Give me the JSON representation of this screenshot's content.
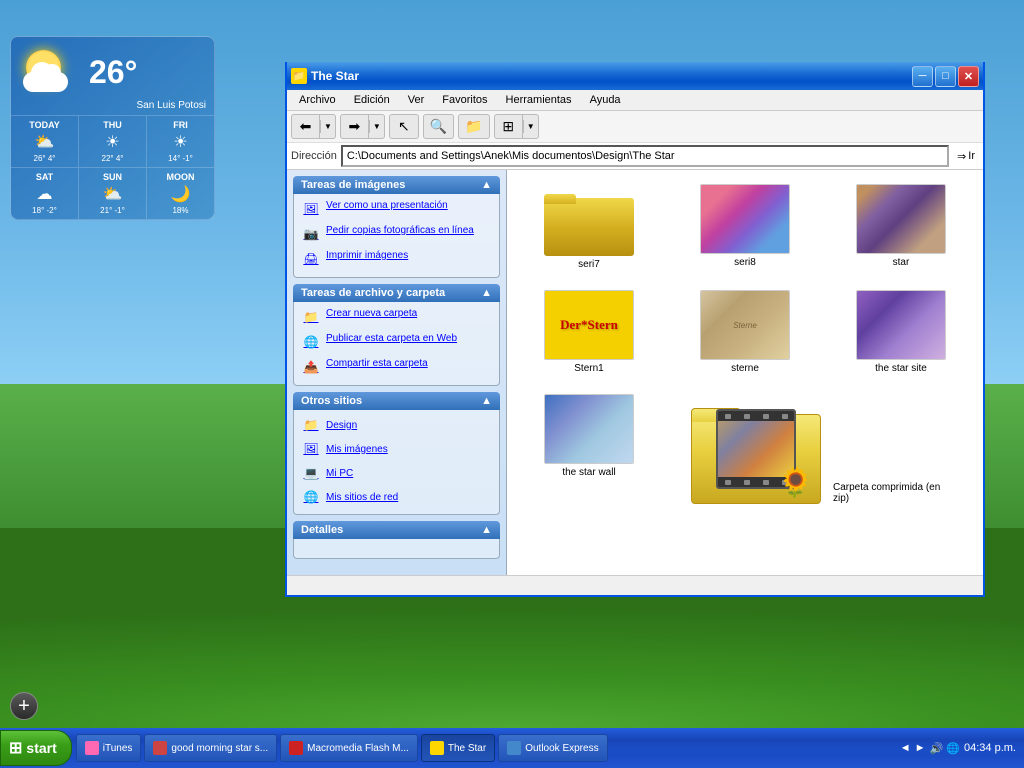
{
  "desktop": {
    "background": "Windows XP Bliss"
  },
  "taskbar": {
    "start_label": "start",
    "clock": "04:34 p.m.",
    "buttons": [
      {
        "id": "itunes",
        "label": "iTunes",
        "color": "#ff69b4",
        "active": false
      },
      {
        "id": "good-morning",
        "label": "good morning star s...",
        "color": "#cc4444",
        "active": false
      },
      {
        "id": "macromedia",
        "label": "Macromedia Flash M...",
        "color": "#cc2222",
        "active": false
      },
      {
        "id": "the-star",
        "label": "The Star",
        "color": "#ffd700",
        "active": true
      },
      {
        "id": "outlook",
        "label": "Outlook Express",
        "color": "#4488cc",
        "active": false
      }
    ]
  },
  "weather": {
    "temp_today": "26°",
    "location": "San Luis Potosi",
    "days": [
      {
        "name": "TODAY",
        "icon": "⛅",
        "hi": "26°",
        "lo": "4°"
      },
      {
        "name": "THU",
        "icon": "☀",
        "hi": "22°",
        "lo": "4°"
      },
      {
        "name": "FRI",
        "icon": "☀",
        "hi": "14°",
        "lo": "-1°"
      }
    ],
    "forecast": [
      {
        "name": "SAT",
        "icon": "☁",
        "hi": "18°",
        "lo": "-2°"
      },
      {
        "name": "SUN",
        "icon": "⛅",
        "hi": "21°",
        "lo": "-1°"
      },
      {
        "name": "MOON",
        "icon": "🌙",
        "value": "18%"
      }
    ]
  },
  "explorer": {
    "title": "The Star",
    "address": "C:\\Documents and Settings\\Anek\\Mis documentos\\Design\\The Star",
    "address_label": "Dirección",
    "go_label": "Ir",
    "menu": {
      "items": [
        "Archivo",
        "Edición",
        "Ver",
        "Favoritos",
        "Herramientas",
        "Ayuda"
      ]
    },
    "toolbar": {
      "back_arrow": "◄",
      "forward_arrow": "►",
      "dropdown": "▼"
    },
    "sidebar": {
      "sections": [
        {
          "id": "image-tasks",
          "header": "Tareas de imágenes",
          "links": [
            {
              "icon": "🖼",
              "label": "Ver como una presentación"
            },
            {
              "icon": "📷",
              "label": "Pedir copias fotográficas en línea"
            },
            {
              "icon": "🖨",
              "label": "Imprimir imágenes"
            }
          ]
        },
        {
          "id": "file-tasks",
          "header": "Tareas de archivo y carpeta",
          "links": [
            {
              "icon": "📁",
              "label": "Crear nueva carpeta"
            },
            {
              "icon": "🌐",
              "label": "Publicar esta carpeta en Web"
            },
            {
              "icon": "📤",
              "label": "Compartir esta carpeta"
            }
          ]
        },
        {
          "id": "other-sites",
          "header": "Otros sitios",
          "links": [
            {
              "icon": "📁",
              "label": "Design"
            },
            {
              "icon": "🖼",
              "label": "Mis imágenes"
            },
            {
              "icon": "💻",
              "label": "Mi PC"
            },
            {
              "icon": "🌐",
              "label": "Mis sitios de red"
            }
          ]
        },
        {
          "id": "details",
          "header": "Detalles",
          "links": []
        }
      ]
    },
    "files": [
      {
        "id": "seri7",
        "name": "seri7",
        "type": "folder"
      },
      {
        "id": "seri8",
        "name": "seri8",
        "type": "image-colorful"
      },
      {
        "id": "star",
        "name": "star",
        "type": "image-vintage"
      },
      {
        "id": "stern1",
        "name": "Stern1",
        "type": "image-stern"
      },
      {
        "id": "sterne",
        "name": "sterne",
        "type": "image-sterne"
      },
      {
        "id": "the-star-site",
        "name": "the star site",
        "type": "image-starsite"
      },
      {
        "id": "the-star-wall",
        "name": "the star wall",
        "type": "image-starwall"
      },
      {
        "id": "zip-folder",
        "name": "Carpeta comprimida (en zip)",
        "type": "folder-zip"
      }
    ],
    "status": ""
  },
  "add_button_label": "+"
}
